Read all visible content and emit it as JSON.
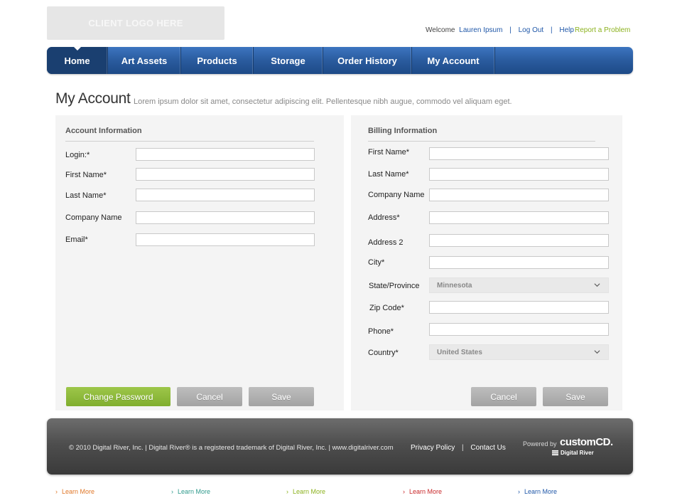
{
  "header": {
    "logo_text": "CLIENT LOGO HERE",
    "welcome": "Welcome",
    "user_name": "Lauren Ipsum",
    "logout": "Log Out",
    "help": "Help",
    "report": "Report a Problem",
    "separator": "|"
  },
  "nav": {
    "tabs": [
      {
        "label": "Home",
        "active": true
      },
      {
        "label": "Art Assets"
      },
      {
        "label": "Products"
      },
      {
        "label": "Storage"
      },
      {
        "label": "Order History"
      },
      {
        "label": "My Account"
      }
    ]
  },
  "page": {
    "title": "My Account",
    "subtitle": "Lorem ipsum dolor sit amet, consectetur adipiscing elit. Pellentesque nibh augue, commodo vel aliquam eget."
  },
  "account": {
    "heading": "Account Information",
    "fields": [
      "Login:*",
      "First Name*",
      "Last Name*",
      "Company Name",
      "Email*"
    ],
    "buttons": {
      "change_password": "Change Password",
      "cancel": "Cancel",
      "save": "Save"
    }
  },
  "billing": {
    "heading": "Billing Information",
    "fields": [
      "First Name*",
      "Last Name*",
      "Company Name",
      "Address*",
      "Address 2",
      "City*",
      "State/Province",
      "Zip Code*",
      "Phone*",
      "Country*"
    ],
    "state_value": "Minnesota",
    "country_value": "United States",
    "buttons": {
      "cancel": "Cancel",
      "save": "Save"
    }
  },
  "footer": {
    "copyright": "© 2010 Digital River, Inc. | Digital River® is a registered trademark of Digital River, Inc. | www.digitalriver.com",
    "privacy": "Privacy Policy",
    "contact": "Contact Us",
    "separator": "|",
    "powered_by": "Powered by",
    "brand": "customCD.",
    "brand_sub": "Digital River"
  },
  "learn_more": [
    {
      "label": "Learn More",
      "color": "#e0782a"
    },
    {
      "label": "Learn More",
      "color": "#2f9a8c"
    },
    {
      "label": "Learn More",
      "color": "#8cb21f"
    },
    {
      "label": "Learn More",
      "color": "#c8282a"
    },
    {
      "label": "Learn More",
      "color": "#1f57a8"
    }
  ],
  "colors": {
    "nav_blue": "#2a5b9e",
    "accent_green": "#8cb21f",
    "link_blue": "#1f57a8"
  }
}
